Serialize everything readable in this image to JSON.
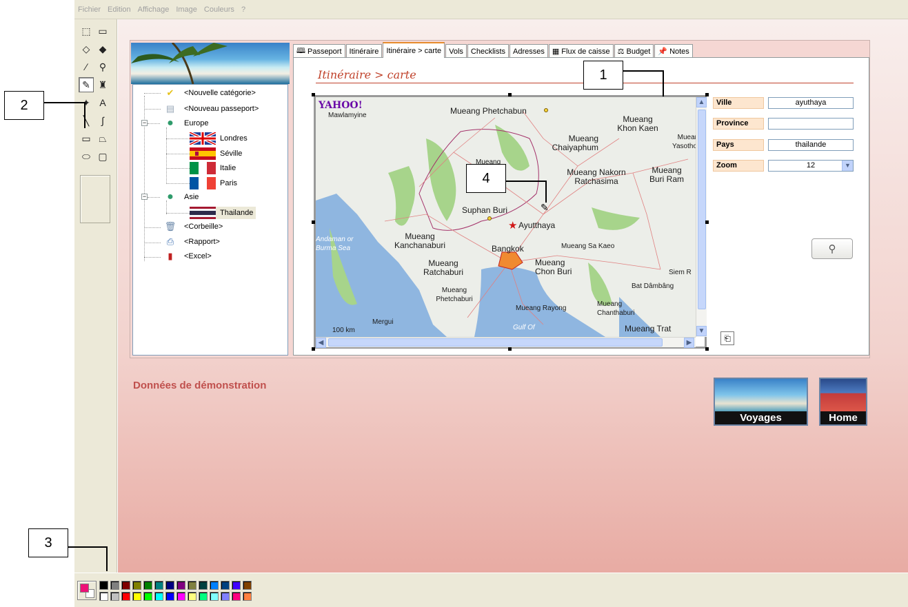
{
  "menu": [
    "Fichier",
    "Edition",
    "Affichage",
    "Image",
    "Couleurs",
    "?"
  ],
  "tools": [
    {
      "name": "free-select-icon",
      "glyph": "⬚"
    },
    {
      "name": "rect-select-icon",
      "glyph": "▭"
    },
    {
      "name": "eraser-icon",
      "glyph": "◇"
    },
    {
      "name": "fill-bucket-icon",
      "glyph": "◆"
    },
    {
      "name": "color-picker-icon",
      "glyph": "∕"
    },
    {
      "name": "magnifier-icon",
      "glyph": "⚲"
    },
    {
      "name": "pencil-icon",
      "glyph": "✎"
    },
    {
      "name": "brush-icon",
      "glyph": "♜"
    },
    {
      "name": "airbrush-icon",
      "glyph": "✦"
    },
    {
      "name": "text-tool-icon",
      "glyph": "A"
    },
    {
      "name": "line-tool-icon",
      "glyph": "╲"
    },
    {
      "name": "curve-tool-icon",
      "glyph": "∫"
    },
    {
      "name": "rectangle-tool-icon",
      "glyph": "▭"
    },
    {
      "name": "polygon-tool-icon",
      "glyph": "⏢"
    },
    {
      "name": "ellipse-tool-icon",
      "glyph": "⬭"
    },
    {
      "name": "rounded-rect-tool-icon",
      "glyph": "▢"
    }
  ],
  "palette": {
    "foreground": "#ee1177",
    "background": "#ffffff",
    "row1": [
      "#000000",
      "#808080",
      "#800000",
      "#808000",
      "#008000",
      "#008080",
      "#000080",
      "#800080",
      "#808040",
      "#004040",
      "#0080ff",
      "#004080",
      "#4000ff",
      "#804000"
    ],
    "row2": [
      "#ffffff",
      "#c0c0c0",
      "#ff0000",
      "#ffff00",
      "#00ff00",
      "#00ffff",
      "#0000ff",
      "#ff00ff",
      "#ffff80",
      "#00ff80",
      "#80ffff",
      "#8080ff",
      "#ff0080",
      "#ff8040"
    ]
  },
  "tree": {
    "new_category": "<Nouvelle catégorie>",
    "new_passport": "<Nouveau passeport>",
    "europe": "Europe",
    "london": "Londres",
    "seville": "Séville",
    "italy": "Italie",
    "paris": "Paris",
    "asia": "Asie",
    "thailand": "Thailande",
    "trash": "<Corbeille>",
    "report": "<Rapport>",
    "excel": "<Excel>"
  },
  "tabs": {
    "passport": "Passeport",
    "itinerary": "Itinéraire",
    "itinerary_map": "Itinéraire > carte",
    "flights": "Vols",
    "checklists": "Checklists",
    "addresses": "Adresses",
    "cashflow": "Flux de caisse",
    "budget": "Budget",
    "notes": "Notes"
  },
  "section_title": "Itinéraire > carte",
  "map": {
    "logo": "YAHOO!",
    "scale": "100 km",
    "andaman": "Andaman or Burma Sea",
    "gulf": "Gulf Of",
    "cities": {
      "mawlamyine": "Mawlamyine",
      "phetchabun": "Mueang Phetchabun",
      "khonkaen": "Mueang Khon Kaen",
      "yasothon": "Muear Yasotho",
      "chaiyaphum": "Mueang Chaiyaphum",
      "mueang": "Mueang",
      "nakorn": "Mueang Nakorn Ratchasima",
      "buriram": "Mueang Buri Ram",
      "suphan": "Suphan Buri",
      "ayutthaya": "Ayutthaya",
      "kanchanaburi": "Mueang Kanchanaburi",
      "bangkok": "Bangkok",
      "sakaeo": "Mueang Sa Kaeo",
      "ratchaburi": "Mueang Ratchaburi",
      "chonburi": "Mueang Chon Buri",
      "siemreap": "Siem R",
      "battambang": "Bat Dâmbâng",
      "phetchaburi": "Mueang Phetchaburi",
      "rayong": "Mueang Rayong",
      "chanthaburi": "Mueang Chanthaburi",
      "mergui": "Mergui",
      "trat": "Mueang Trat"
    }
  },
  "form": {
    "city_label": "Ville",
    "city_value": "ayuthaya",
    "province_label": "Province",
    "province_value": "",
    "country_label": "Pays",
    "country_value": "thailande",
    "zoom_label": "Zoom",
    "zoom_value": "12"
  },
  "demo_label": "Données de démonstration",
  "nav": {
    "voyages": "Voyages",
    "home": "Home"
  },
  "callouts": {
    "c1": "1",
    "c2": "2",
    "c3": "3",
    "c4": "4"
  }
}
